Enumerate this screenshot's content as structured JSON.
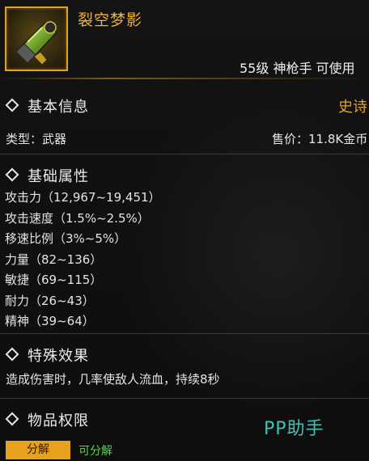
{
  "item": {
    "name": "裂空梦影",
    "level_line": "55级 神枪手 可使用"
  },
  "basic_info": {
    "title": "基本信息",
    "rarity": "史诗",
    "type_text": "类型：武器",
    "price_text": "售价：11.8K金币"
  },
  "base_attributes": {
    "title": "基础属性",
    "items": [
      "攻击力（12,967~19,451）",
      "攻击速度（1.5%~2.5%）",
      "移速比例（3%~5%）",
      "力量（82~136）",
      "敏捷（69~115）",
      "耐力（26~43）",
      "精神（39~64）"
    ]
  },
  "special_effect": {
    "title": "特殊效果",
    "text": "造成伤害时，几率使敌人流血，持续8秒"
  },
  "permissions": {
    "title": "物品权限",
    "decompose_label": "分解",
    "decompose_status": "可分解"
  },
  "watermark": "PP助手",
  "colors": {
    "gold": "#f2b233",
    "green": "#55d34a",
    "teal": "#3fc3b3"
  },
  "icons": [
    "diamond-bullet-icon",
    "weapon-item-icon"
  ]
}
